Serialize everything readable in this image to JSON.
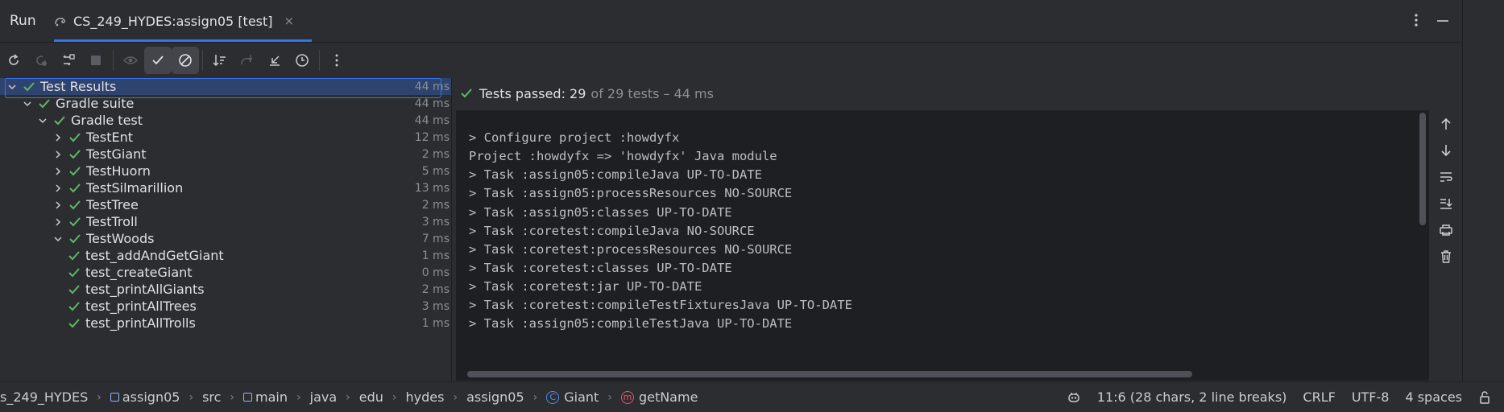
{
  "header": {
    "run_label": "Run",
    "tab_label": "CS_249_HYDES:assign05 [test]",
    "tab_close": "×"
  },
  "tree": {
    "rows": [
      {
        "name": "Test Results",
        "time": "44 ms"
      },
      {
        "name": "Gradle suite",
        "time": "44 ms"
      },
      {
        "name": "Gradle test",
        "time": "44 ms"
      },
      {
        "name": "TestEnt",
        "time": "12 ms"
      },
      {
        "name": "TestGiant",
        "time": "2 ms"
      },
      {
        "name": "TestHuorn",
        "time": "5 ms"
      },
      {
        "name": "TestSilmarillion",
        "time": "13 ms"
      },
      {
        "name": "TestTree",
        "time": "2 ms"
      },
      {
        "name": "TestTroll",
        "time": "3 ms"
      },
      {
        "name": "TestWoods",
        "time": "7 ms"
      },
      {
        "name": "test_addAndGetGiant",
        "time": "1 ms"
      },
      {
        "name": "test_createGiant",
        "time": "0 ms"
      },
      {
        "name": "test_printAllGiants",
        "time": "2 ms"
      },
      {
        "name": "test_printAllTrees",
        "time": "3 ms"
      },
      {
        "name": "test_printAllTrolls",
        "time": "1 ms"
      }
    ]
  },
  "status": {
    "passed": "Tests passed: 29",
    "detail": "of 29 tests – 44 ms"
  },
  "console": {
    "lines": [
      "",
      "> Configure project :howdyfx",
      "Project :howdyfx => 'howdyfx' Java module",
      "> Task :assign05:compileJava UP-TO-DATE",
      "> Task :assign05:processResources NO-SOURCE",
      "> Task :assign05:classes UP-TO-DATE",
      "> Task :coretest:compileJava NO-SOURCE",
      "> Task :coretest:processResources NO-SOURCE",
      "> Task :coretest:classes UP-TO-DATE",
      "> Task :coretest:jar UP-TO-DATE",
      "> Task :coretest:compileTestFixturesJava UP-TO-DATE",
      "> Task :assign05:compileTestJava UP-TO-DATE"
    ]
  },
  "breadcrumb": {
    "items": [
      "s_249_HYDES",
      "assign05",
      "src",
      "main",
      "java",
      "edu",
      "hydes",
      "assign05",
      "Giant",
      "getName"
    ],
    "class_icon_letter": "C",
    "method_icon_letter": "m",
    "separator": "›"
  },
  "statusbar": {
    "position": "11:6 (28 chars, 2 line breaks)",
    "line_sep": "CRLF",
    "encoding": "UTF-8",
    "indent": "4 spaces"
  },
  "colors": {
    "pass": "#5fb865",
    "accent": "#3574f0",
    "selection": "#2e436e"
  }
}
